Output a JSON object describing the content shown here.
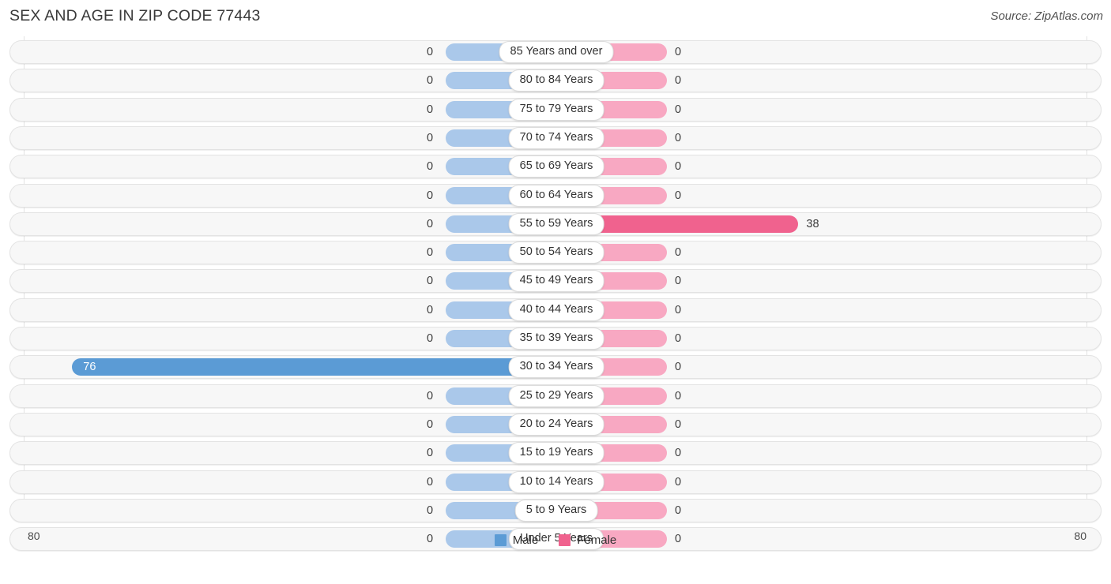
{
  "header": {
    "title": "SEX AND AGE IN ZIP CODE 77443",
    "source": "Source: ZipAtlas.com"
  },
  "legend": {
    "male_label": "Male",
    "female_label": "Female"
  },
  "axis": {
    "left_tick": "80",
    "right_tick": "80"
  },
  "colors": {
    "male_strong": "#5b9bd5",
    "male_light": "#aac8ea",
    "female_strong": "#f0628e",
    "female_light": "#f8a8c2",
    "track": "#f7f7f7",
    "track_border": "#e3e3e3"
  },
  "chart_data": {
    "type": "bar",
    "title": "SEX AND AGE IN ZIP CODE 77443",
    "subtitle": "Source: ZipAtlas.com",
    "orientation": "horizontal",
    "layout": "population-pyramid",
    "xlabel": "",
    "ylabel": "",
    "xlim": [
      80,
      80
    ],
    "axis_ticks": [
      "80",
      "80"
    ],
    "grid": false,
    "legend_position": "bottom-center",
    "categories": [
      "85 Years and over",
      "80 to 84 Years",
      "75 to 79 Years",
      "70 to 74 Years",
      "65 to 69 Years",
      "60 to 64 Years",
      "55 to 59 Years",
      "50 to 54 Years",
      "45 to 49 Years",
      "40 to 44 Years",
      "35 to 39 Years",
      "30 to 34 Years",
      "25 to 29 Years",
      "20 to 24 Years",
      "15 to 19 Years",
      "10 to 14 Years",
      "5 to 9 Years",
      "Under 5 Years"
    ],
    "series": [
      {
        "name": "Male",
        "color": "#5b9bd5",
        "side": "left",
        "values": [
          0,
          0,
          0,
          0,
          0,
          0,
          0,
          0,
          0,
          0,
          0,
          76,
          0,
          0,
          0,
          0,
          0,
          0
        ]
      },
      {
        "name": "Female",
        "color": "#f0628e",
        "side": "right",
        "values": [
          0,
          0,
          0,
          0,
          0,
          0,
          38,
          0,
          0,
          0,
          0,
          0,
          0,
          0,
          0,
          0,
          0,
          0
        ]
      }
    ],
    "male_labels": [
      "0",
      "0",
      "0",
      "0",
      "0",
      "0",
      "0",
      "0",
      "0",
      "0",
      "0",
      "76",
      "0",
      "0",
      "0",
      "0",
      "0",
      "0"
    ],
    "female_labels": [
      "0",
      "0",
      "0",
      "0",
      "0",
      "0",
      "38",
      "0",
      "0",
      "0",
      "0",
      "0",
      "0",
      "0",
      "0",
      "0",
      "0",
      "0"
    ]
  }
}
